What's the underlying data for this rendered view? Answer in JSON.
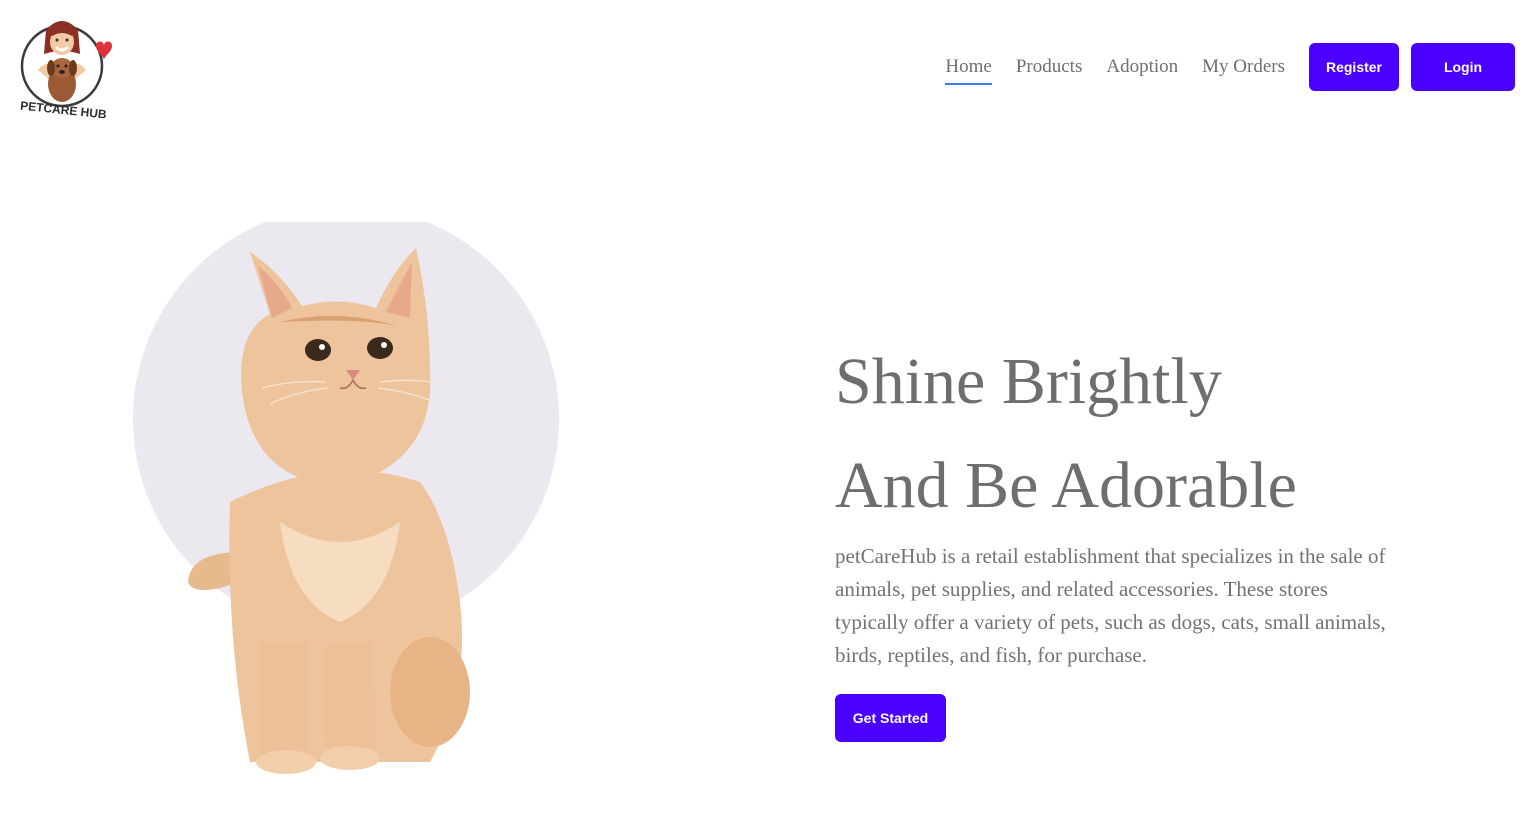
{
  "brand": {
    "logo_text": "PETCARE HUB",
    "logo_icon": "girl-hugging-dog-heart-logo"
  },
  "nav": {
    "items": [
      {
        "label": "Home",
        "active": true
      },
      {
        "label": "Products",
        "active": false
      },
      {
        "label": "Adoption",
        "active": false
      },
      {
        "label": "My Orders",
        "active": false
      }
    ],
    "register_label": "Register",
    "login_label": "Login"
  },
  "hero": {
    "headline_line1": "Shine Brightly",
    "headline_line2": "And Be Adorable",
    "description": "petCareHub is a retail establishment that specializes in the sale of animals, pet supplies, and related accessories. These stores typically offer a variety of pets, such as dogs, cats, small animals, birds, reptiles, and fish, for purchase.",
    "cta_label": "Get Started",
    "image_icon": "orange-kitten-photo"
  },
  "colors": {
    "accent": "#4a00ff",
    "nav_underline": "#3d7be8",
    "text_gray": "#6e6e6e",
    "circle_bg": "#ebe8f0"
  }
}
